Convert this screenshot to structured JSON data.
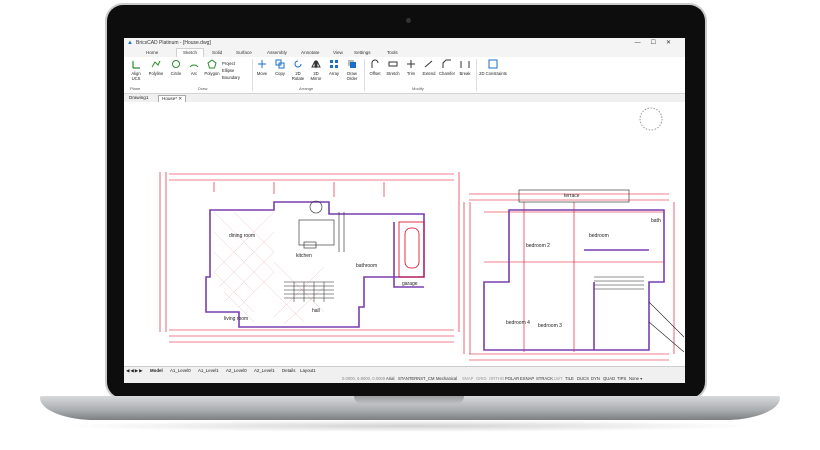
{
  "app": {
    "title": "BricsCAD Platinum - [House.dwg]",
    "window_controls": [
      "—",
      "☐",
      "✕"
    ]
  },
  "ribbon_tabs": [
    "Home",
    "Sketch",
    "Solid",
    "Surface",
    "Assembly",
    "Annotate",
    "View",
    "Settings",
    "Tools"
  ],
  "active_ribbon_tab": "Sketch",
  "ribbon_tools": [
    {
      "label": "Align UCS",
      "icon": "align-ucs-icon"
    },
    {
      "label": "Polyline",
      "icon": "polyline-icon"
    },
    {
      "label": "Circle",
      "icon": "circle-icon"
    },
    {
      "label": "Arc",
      "icon": "arc-icon"
    },
    {
      "label": "Polygon",
      "icon": "polygon-icon"
    },
    {
      "label": "Move",
      "icon": "move-icon"
    },
    {
      "label": "Copy",
      "icon": "copy-icon"
    },
    {
      "label": "2D Rotate",
      "icon": "rotate-icon"
    },
    {
      "label": "2D Mirror",
      "icon": "mirror-icon"
    },
    {
      "label": "Array",
      "icon": "array-icon"
    },
    {
      "label": "Draw Order",
      "icon": "draw-order-icon"
    },
    {
      "label": "Offset",
      "icon": "offset-icon"
    },
    {
      "label": "Stretch",
      "icon": "stretch-icon"
    },
    {
      "label": "Trim",
      "icon": "trim-icon"
    },
    {
      "label": "Extend",
      "icon": "extend-icon"
    },
    {
      "label": "Chamfer",
      "icon": "chamfer-icon"
    },
    {
      "label": "Break",
      "icon": "break-icon"
    },
    {
      "label": "2D Constraints",
      "icon": "constraints-icon"
    }
  ],
  "ribbon_small_tools": [
    "Project",
    "Ellipse",
    "Boundary"
  ],
  "ribbon_groups": [
    "Plane",
    "Draw",
    "Arrange",
    "Modify"
  ],
  "document_tabs": [
    "Drawing1",
    "House*"
  ],
  "active_document_tab": "House*",
  "plan_labels": {
    "dining_room": "dining room",
    "kitchen": "kitchen",
    "living_room": "living room",
    "hall": "hall",
    "garage": "garage",
    "bathroom": "bathroom",
    "bedroom2": "bedroom 2",
    "bedroom1": "bedroom",
    "bedroom4": "bedroom 4",
    "bedroom3": "bedroom 3",
    "terrace": "terrace",
    "bath2": "bath"
  },
  "layout_tabs": [
    "Model",
    "A1_Level0",
    "A1_Level1",
    "A2_Level0",
    "A2_Level1",
    "Details",
    "Layout1"
  ],
  "status_bar": {
    "coords": "0.0000, 6.8000, 0.0000",
    "font": "Arial",
    "style": "STANTERNST_CM",
    "workspace": "Mechanical",
    "toggles": [
      "SNAP",
      "GRID",
      "ORTHO",
      "POLAR",
      "ESNAP",
      "STRACK",
      "LWT",
      "TILE",
      "DUCS",
      "DYN",
      "QUAD",
      "TIPS"
    ],
    "last": "None"
  },
  "colors": {
    "walls": "#7a3fb0",
    "dimensions": "#e0001b",
    "linework": "#222222",
    "accent": "#1a6fc9"
  }
}
